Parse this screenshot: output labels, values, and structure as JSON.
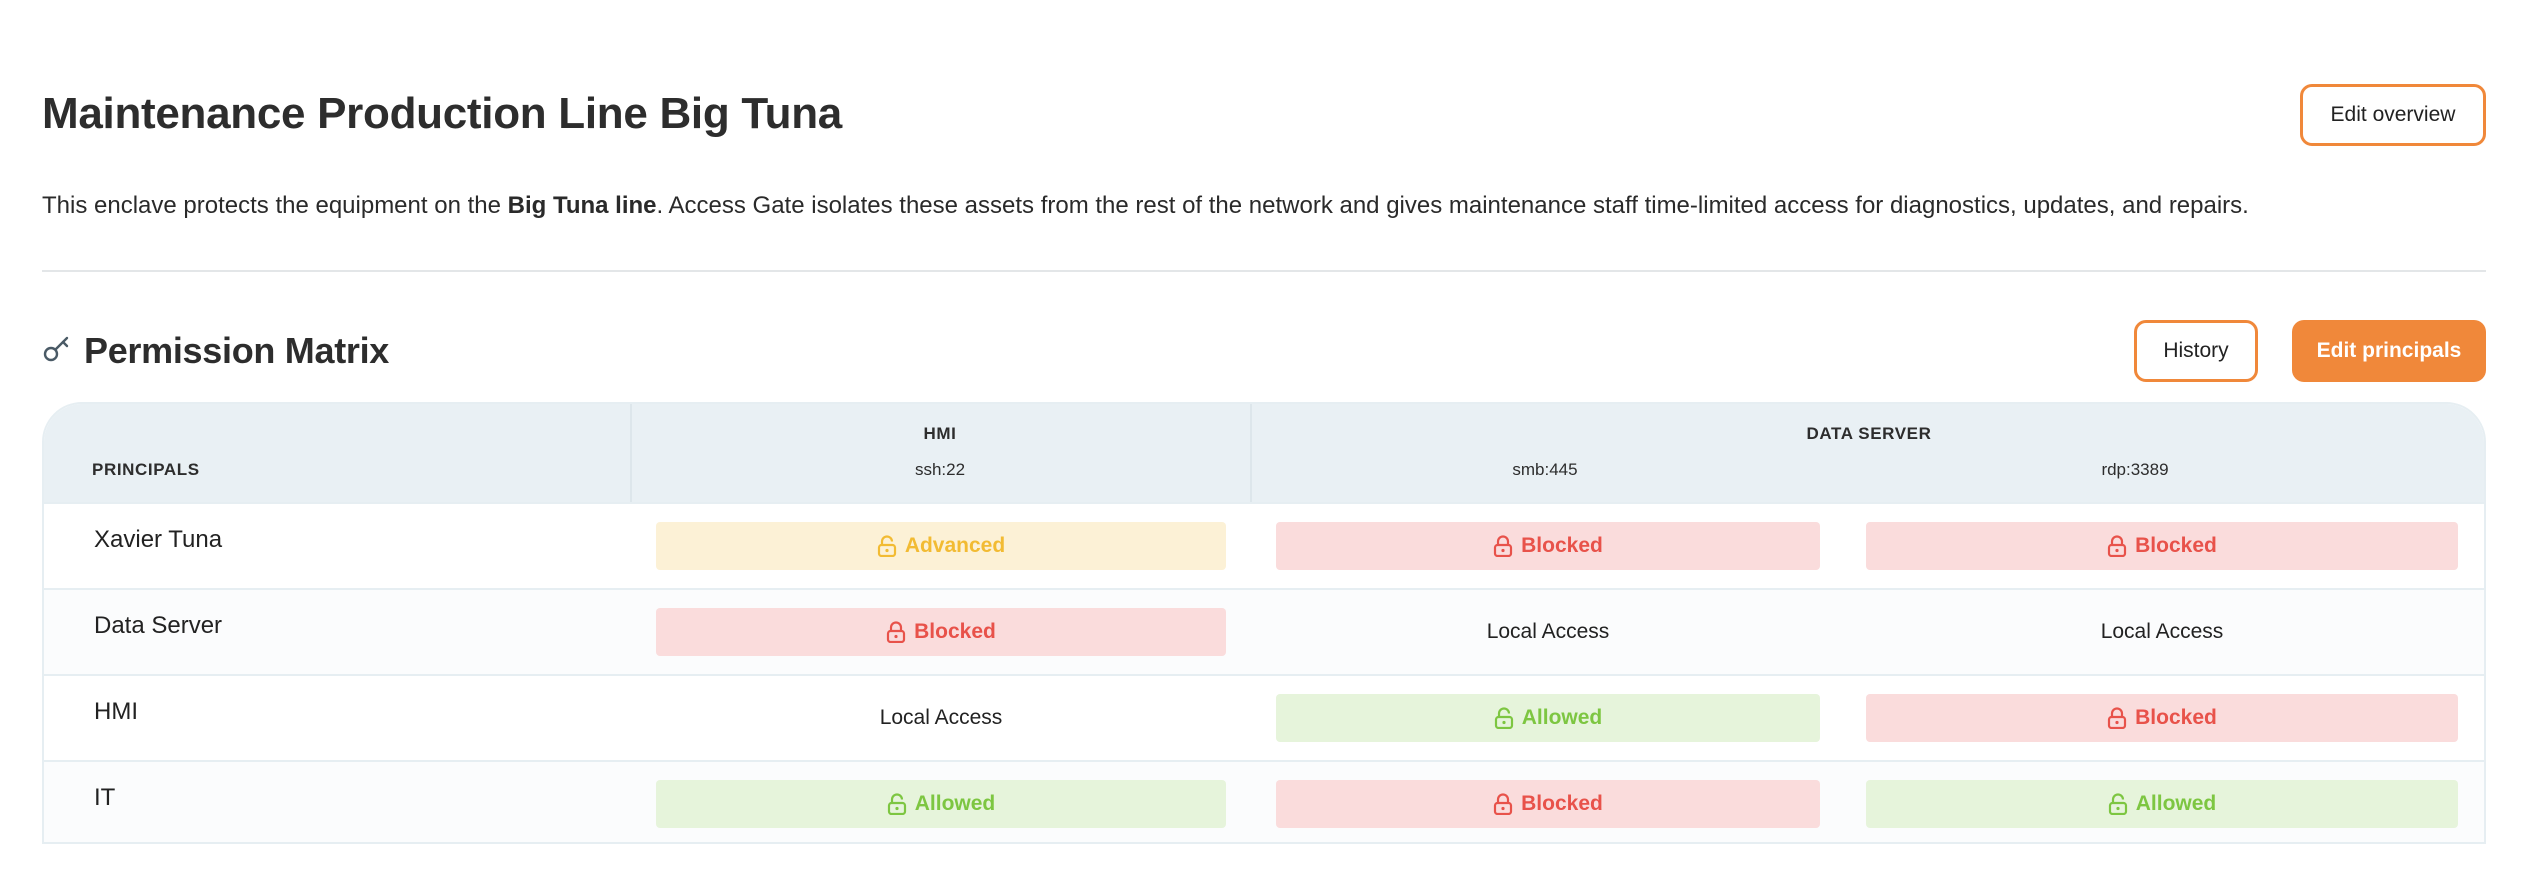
{
  "header": {
    "title": "Maintenance Production Line Big Tuna",
    "edit_overview_label": "Edit overview"
  },
  "description": {
    "before": "This enclave protects the equipment on the ",
    "bold": "Big Tuna line",
    "after": ". Access Gate isolates these assets from the rest of the network and gives maintenance staff time-limited access for diagnostics, updates, and repairs."
  },
  "section": {
    "title": "Permission Matrix",
    "icon": "key-icon",
    "history_label": "History",
    "edit_principals_label": "Edit principals"
  },
  "matrix": {
    "principals_header": "PRINCIPALS",
    "groups": [
      {
        "name": "HMI",
        "ports": [
          "ssh:22"
        ]
      },
      {
        "name": "DATA SERVER",
        "ports": [
          "smb:445",
          "rdp:3389"
        ]
      }
    ],
    "rows": [
      {
        "principal": "Xavier Tuna",
        "cells": [
          {
            "status": "advanced",
            "label": "Advanced"
          },
          {
            "status": "blocked",
            "label": "Blocked"
          },
          {
            "status": "blocked",
            "label": "Blocked"
          }
        ]
      },
      {
        "principal": "Data Server",
        "cells": [
          {
            "status": "blocked",
            "label": "Blocked"
          },
          {
            "status": "local",
            "label": "Local Access"
          },
          {
            "status": "local",
            "label": "Local Access"
          }
        ]
      },
      {
        "principal": "HMI",
        "cells": [
          {
            "status": "local",
            "label": "Local Access"
          },
          {
            "status": "allowed",
            "label": "Allowed"
          },
          {
            "status": "blocked",
            "label": "Blocked"
          }
        ]
      },
      {
        "principal": "IT",
        "cells": [
          {
            "status": "allowed",
            "label": "Allowed"
          },
          {
            "status": "blocked",
            "label": "Blocked"
          },
          {
            "status": "allowed",
            "label": "Allowed"
          }
        ]
      }
    ]
  },
  "colors": {
    "accent": "#f0883a",
    "advanced": "#f2bb33",
    "blocked": "#e8524a",
    "allowed": "#7dc641"
  }
}
